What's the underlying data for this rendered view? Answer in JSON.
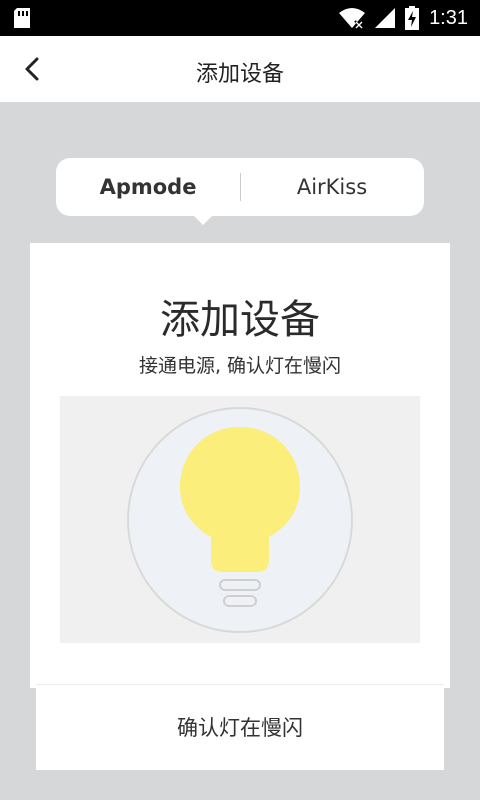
{
  "status_bar": {
    "time": "1:31",
    "icons": [
      "sd-card-icon",
      "wifi-icon",
      "signal-icon",
      "battery-charging-icon"
    ]
  },
  "app_bar": {
    "title": "添加设备",
    "back_icon": "chevron-left-icon"
  },
  "tabs": {
    "items": [
      {
        "label": "Apmode",
        "selected": true
      },
      {
        "label": "AirKiss",
        "selected": false
      }
    ]
  },
  "card": {
    "heading": "添加设备",
    "instruction": "接通电源, 确认灯在慢闪",
    "illustration_icon": "light-bulb-icon",
    "bulb_color": "#fbee7b"
  },
  "confirm_button": {
    "label": "确认灯在慢闪"
  }
}
